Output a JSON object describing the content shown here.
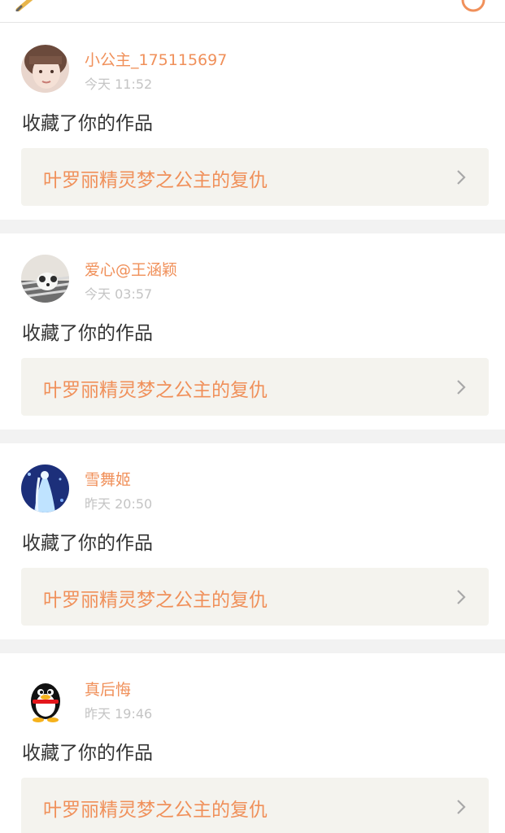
{
  "header": {
    "left_icon": "pencil-icon",
    "right_icon": "circle-icon",
    "accent_color": "#f0905a"
  },
  "notifications": [
    {
      "username": "小公主_175115697",
      "time": "今天 11:52",
      "action": "收藏了你的作品",
      "work_title": "叶罗丽精灵梦之公主的复仇",
      "avatar": "girl-photo-avatar"
    },
    {
      "username": "爱心@王涵颖",
      "time": "今天 03:57",
      "action": "收藏了你的作品",
      "work_title": "叶罗丽精灵梦之公主的复仇",
      "avatar": "puppy-photo-avatar"
    },
    {
      "username": "雪舞姬",
      "time": "昨天 20:50",
      "action": "收藏了你的作品",
      "work_title": "叶罗丽精灵梦之公主的复仇",
      "avatar": "ice-princess-avatar"
    },
    {
      "username": "真后悔",
      "time": "昨天 19:46",
      "action": "收藏了你的作品",
      "work_title": "叶罗丽精灵梦之公主的复仇",
      "avatar": "qq-penguin-avatar"
    }
  ]
}
